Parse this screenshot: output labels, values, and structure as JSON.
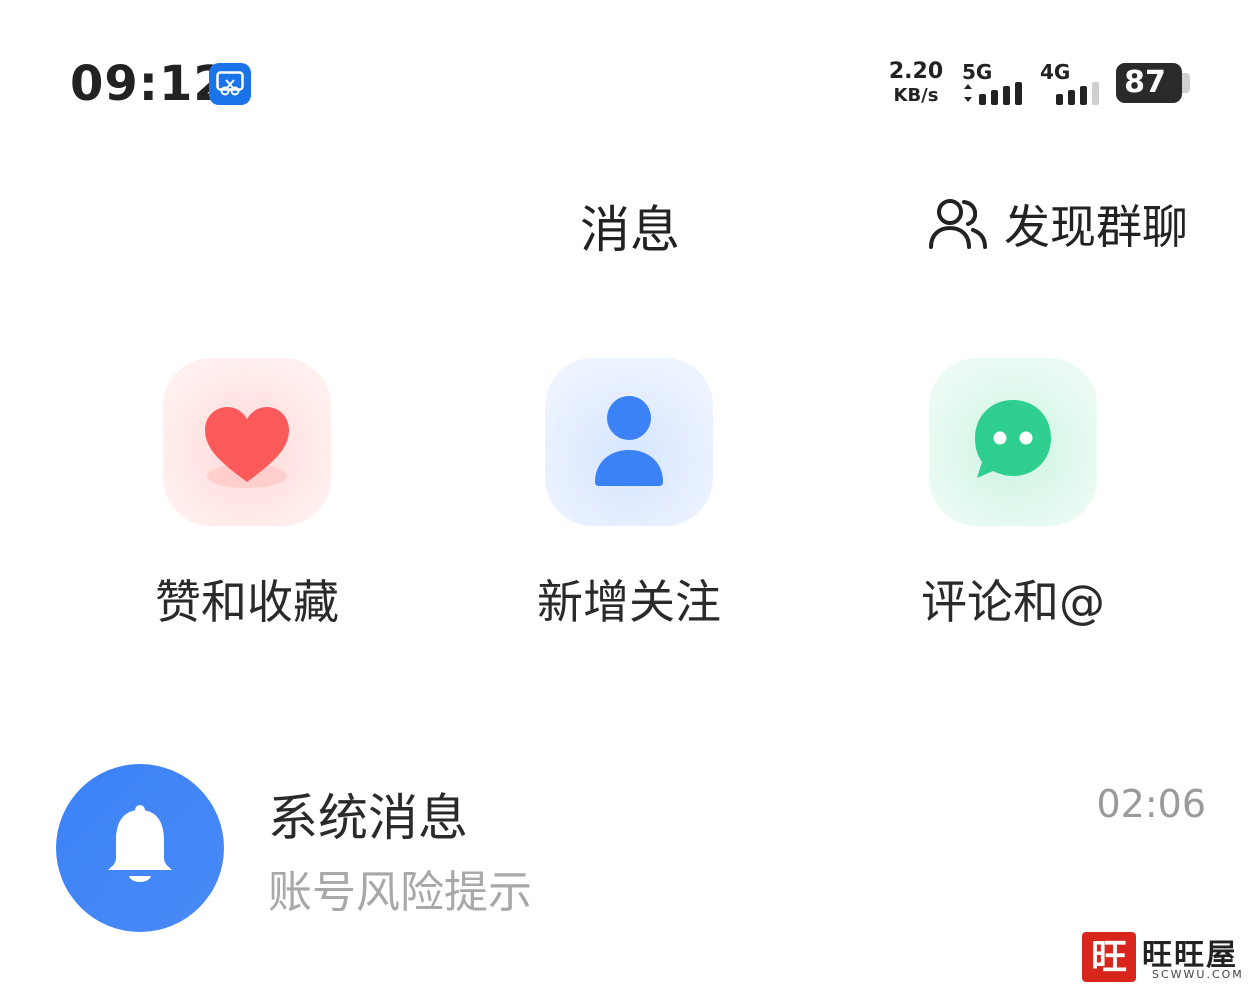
{
  "status_bar": {
    "time": "09:12",
    "app_badge_icon": "screen-recorder-icon",
    "net_speed_value": "2.20",
    "net_speed_unit": "KB/s",
    "signal_1_label": "5G",
    "signal_2_label": "4G",
    "battery_level": "87"
  },
  "header": {
    "title": "消息",
    "discover_group_label": "发现群聊",
    "discover_group_icon": "group-users-icon"
  },
  "quick_entries": [
    {
      "label": "赞和收藏",
      "icon": "heart-icon",
      "color": "#fa5a5a"
    },
    {
      "label": "新增关注",
      "icon": "person-icon",
      "color": "#3b82f6"
    },
    {
      "label": "评论和@",
      "icon": "chat-bubble-icon",
      "color": "#2fd08f"
    }
  ],
  "messages": [
    {
      "title": "系统消息",
      "preview": "账号风险提示",
      "time": "02:06",
      "icon": "bell-icon",
      "color": "#3b82f6"
    }
  ],
  "watermark": {
    "seal": "旺",
    "text": "旺旺屋",
    "sub": "SCWWU.COM"
  }
}
